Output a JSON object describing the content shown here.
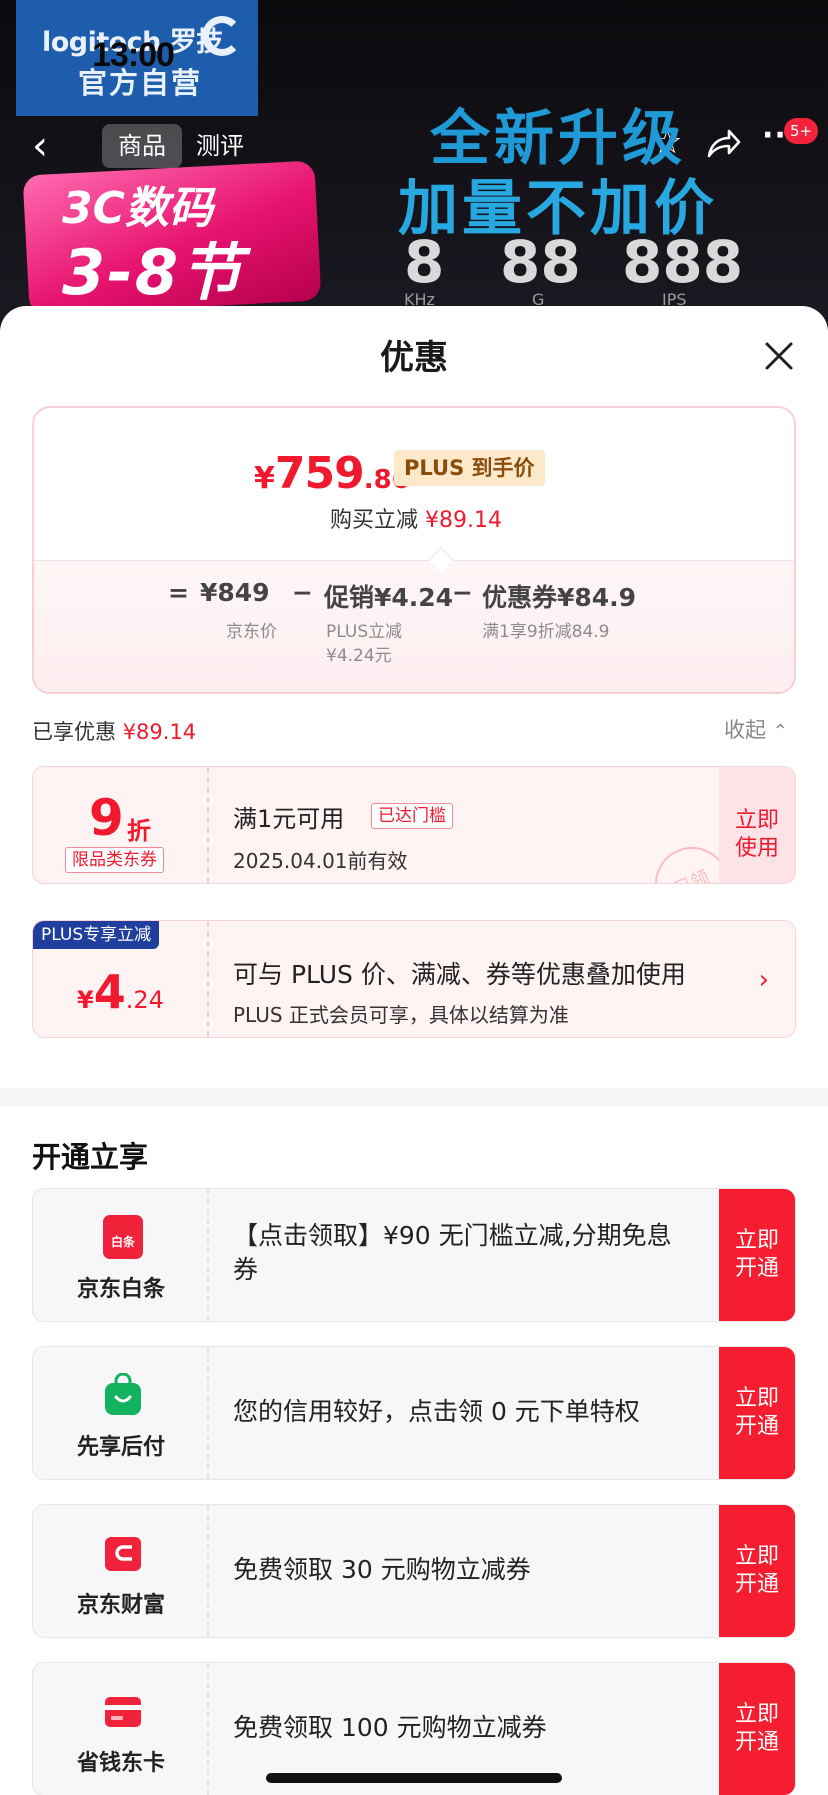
{
  "status": {
    "time": "13:00"
  },
  "brand": {
    "line1": "logitech 罗技",
    "line2": "官方自营"
  },
  "nav": {
    "back_icon": "chevron-left-icon",
    "tabs": [
      {
        "label": "商品",
        "active": true
      },
      {
        "label": "测评",
        "active": false
      }
    ],
    "star_icon": "star-icon",
    "share_icon": "share-icon",
    "more_icon": "more-icon",
    "badge": "5+"
  },
  "promo": {
    "line1": "3C数码",
    "line2": "3-8节"
  },
  "hero": {
    "line1": "全新升级",
    "line2": "加量不加价",
    "specs": [
      {
        "value": "8",
        "unit": "KHz"
      },
      {
        "value": "88",
        "unit": "G"
      },
      {
        "value": "888",
        "unit": "IPS"
      }
    ]
  },
  "sheet": {
    "title": "优惠",
    "close_icon": "close-icon",
    "price": {
      "yen": "¥",
      "integer": "759",
      "decimal": ".86",
      "plus_tag": "PLUS 到手价",
      "instant_label": "购买立减",
      "instant_value": "¥89.14"
    },
    "calc": {
      "eq": "=",
      "minus": "−",
      "items": [
        {
          "main": "¥849",
          "sub": "京东价"
        },
        {
          "main": "促销¥4.24",
          "sub": "PLUS立减\n¥4.24元"
        },
        {
          "main": "优惠券¥84.9",
          "sub": "满1享9折减84.9"
        }
      ]
    },
    "enjoyed": {
      "label": "已享优惠",
      "value": "¥89.14",
      "collapse": "收起"
    },
    "coupon": {
      "big": "9",
      "zhe": "折",
      "tag": "限品类东券",
      "condition": "满1元可用",
      "reached": "已达门槛",
      "validity": "2025.04.01前有效",
      "use": "立即使用",
      "stamp": "已领"
    },
    "plus_card": {
      "ribbon": "PLUS专享立减",
      "yen": "¥",
      "integer": "4",
      "decimal": ".24",
      "line1": "可与 PLUS 价、满减、券等优惠叠加使用",
      "line2": "PLUS 正式会员可享，具体以结算为准"
    },
    "open_title": "开通立享",
    "services": [
      {
        "name": "京东白条",
        "icon": "baitiao-icon",
        "icon_label": "白条",
        "text": "【点击领取】¥90 无门槛立减,分期免息券",
        "button": "立即开通"
      },
      {
        "name": "先享后付",
        "icon": "shopping-bag-icon",
        "icon_label": "",
        "text": "您的信用较好，点击领 0 元下单特权",
        "button": "立即开通"
      },
      {
        "name": "京东财富",
        "icon": "wallet-icon",
        "icon_label": "",
        "text": "免费领取 30 元购物立减券",
        "button": "立即开通"
      },
      {
        "name": "省钱东卡",
        "icon": "card-icon",
        "icon_label": "",
        "text": "免费领取 100 元购物立减券",
        "button": "立即开通"
      }
    ]
  },
  "colors": {
    "accent": "#f0192d",
    "plus_blue": "#203e9e",
    "button_red": "#f51d2f"
  }
}
